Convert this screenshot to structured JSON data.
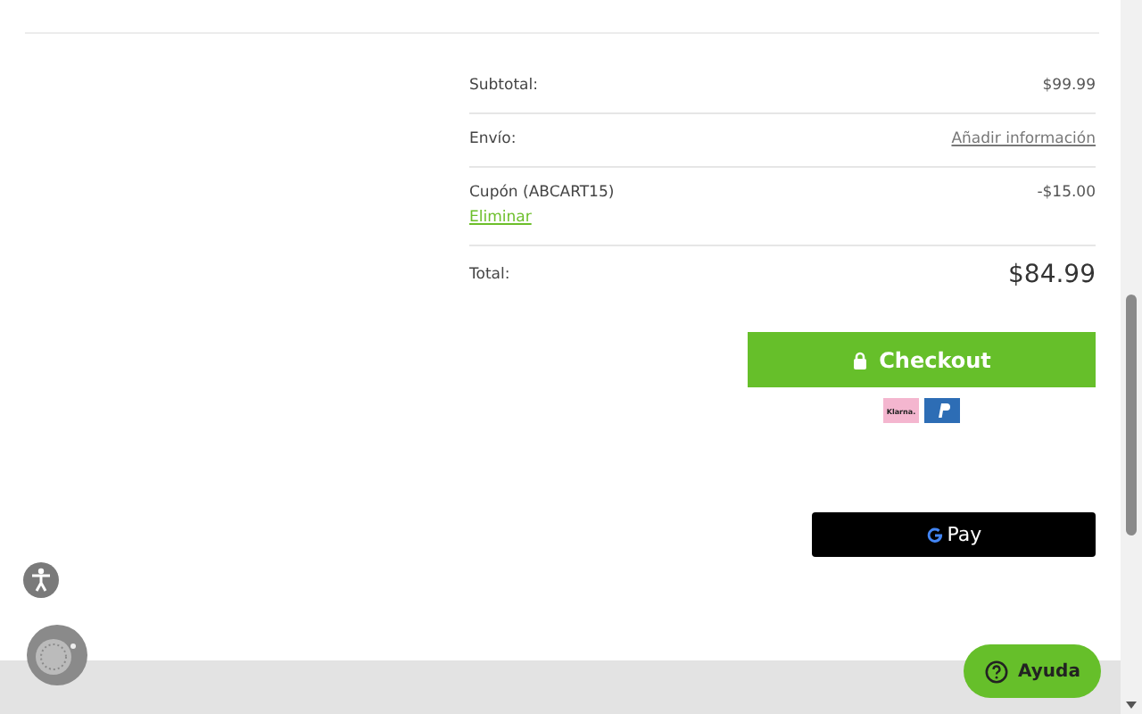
{
  "summary": [
    {
      "kind": "amount",
      "label": "Subtotal:",
      "value": "$99.99"
    },
    {
      "kind": "link",
      "label": "Envío:",
      "value": "Añadir información"
    },
    {
      "kind": "coupon",
      "label": "Cupón (ABCART15)",
      "action": "Eliminar",
      "value": "-$15.00"
    },
    {
      "kind": "total",
      "label": "Total:",
      "value": "$84.99"
    }
  ],
  "checkout_button": "Checkout",
  "klarna_badge": "Klarna.",
  "gpay_button": "Pay",
  "help_button": "Ayuda"
}
